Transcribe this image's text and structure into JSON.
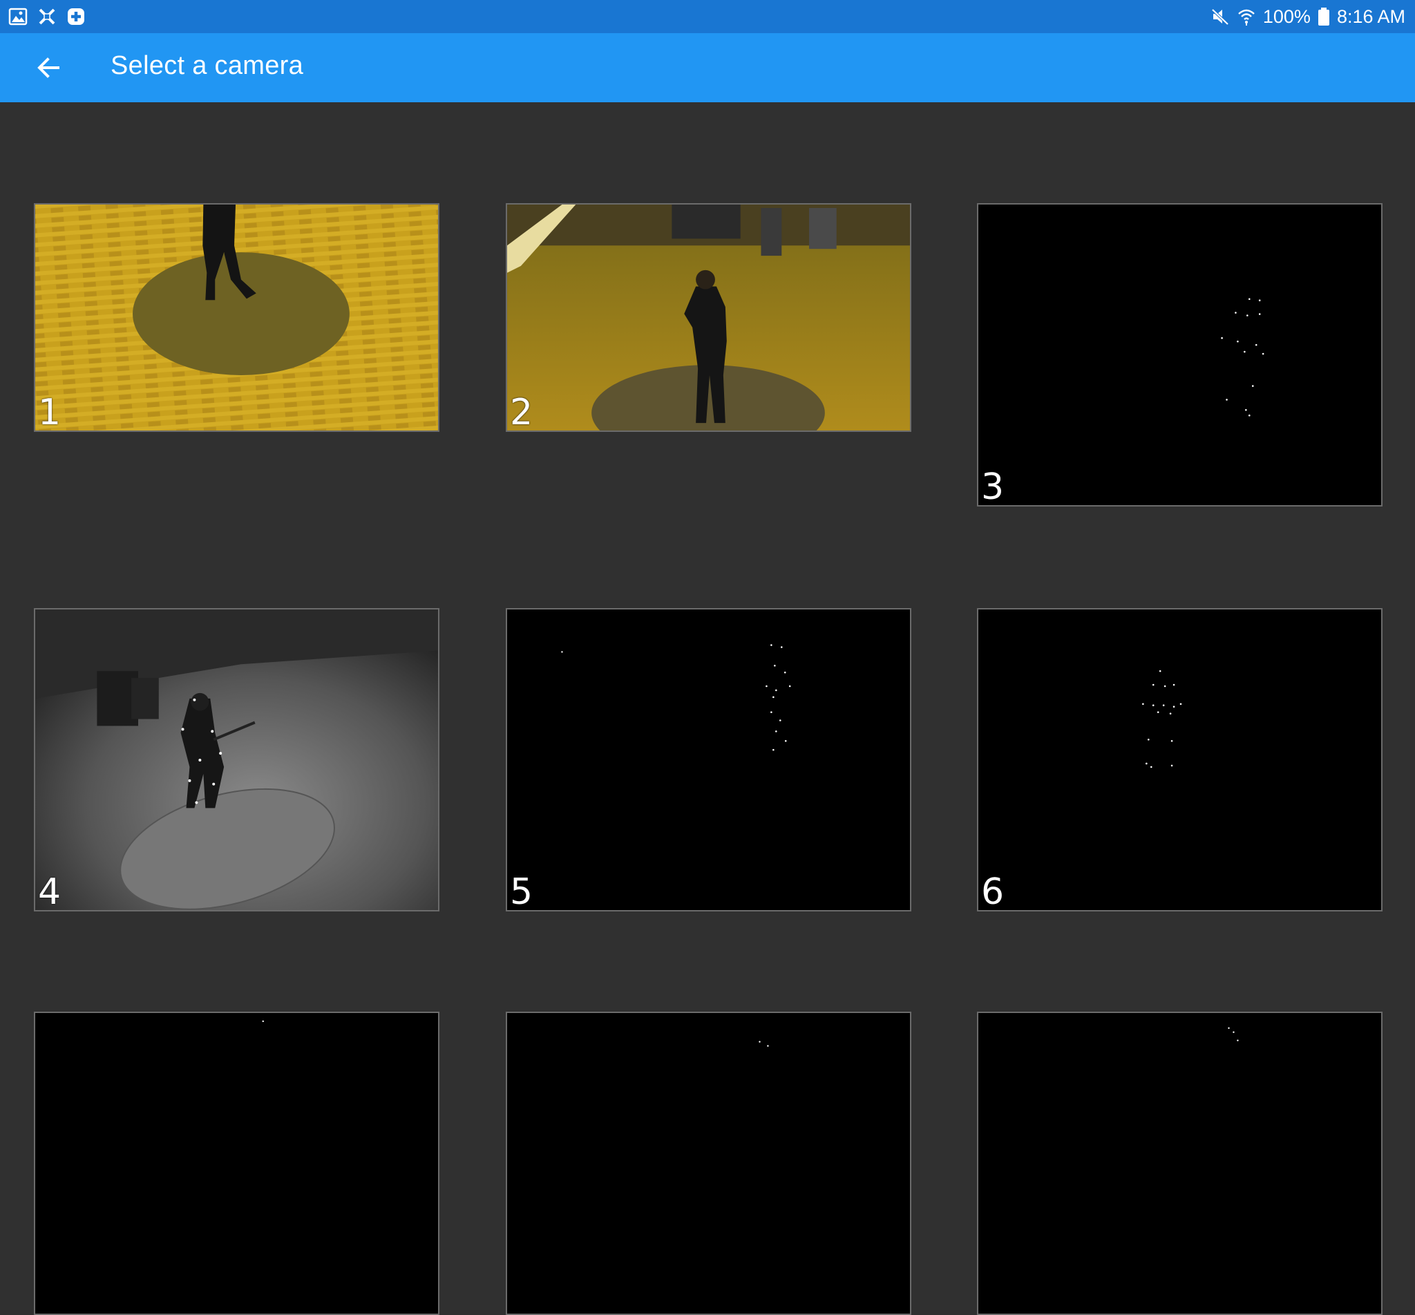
{
  "status_bar": {
    "left_icons": [
      "gallery-icon",
      "app-x-icon",
      "medical-plus-icon"
    ],
    "mute_icon": "mute-icon",
    "wifi_icon": "wifi-icon",
    "battery_percent": "100%",
    "battery_icon": "battery-icon",
    "time": "8:16 AM"
  },
  "app_bar": {
    "back_icon": "back-arrow-icon",
    "title": "Select a camera"
  },
  "cameras": [
    {
      "label": "1",
      "view": "color-overhead"
    },
    {
      "label": "2",
      "view": "color-behind"
    },
    {
      "label": "3",
      "view": "markers"
    },
    {
      "label": "4",
      "view": "grayscale-overhead"
    },
    {
      "label": "5",
      "view": "markers"
    },
    {
      "label": "6",
      "view": "markers"
    },
    {
      "label": "",
      "view": "markers"
    },
    {
      "label": "",
      "view": "markers"
    },
    {
      "label": "",
      "view": "markers"
    }
  ],
  "colors": {
    "status_bar": "#1976d2",
    "app_bar": "#2196f3",
    "background": "#303030",
    "floor_yellow": "#c8a01c"
  }
}
